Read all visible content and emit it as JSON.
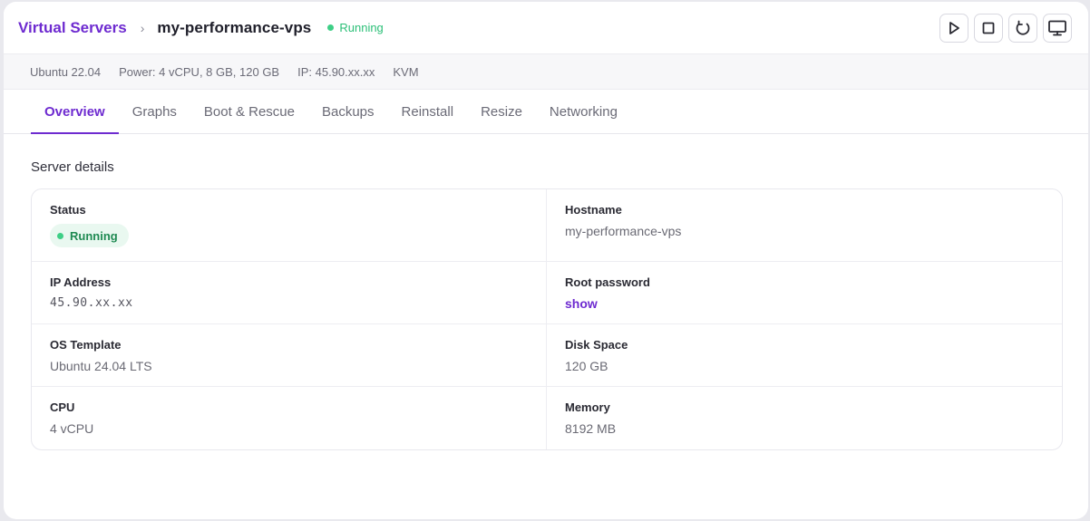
{
  "breadcrumb": {
    "parent_label": "Virtual Servers",
    "separator": "›",
    "server_name": "my-performance-vps",
    "status": "Running"
  },
  "actions": [
    {
      "name": "start-button",
      "icon": "play-icon"
    },
    {
      "name": "stop-button",
      "icon": "stop-icon"
    },
    {
      "name": "restart-button",
      "icon": "restart-icon"
    },
    {
      "name": "console-button",
      "icon": "monitor-icon"
    }
  ],
  "meta": {
    "os": "Ubuntu 22.04",
    "power": "Power: 4 vCPU, 8 GB, 120 GB",
    "ip": "IP: 45.90.xx.xx",
    "virt": "KVM"
  },
  "tabs": [
    {
      "label": "Overview",
      "active": true
    },
    {
      "label": "Graphs"
    },
    {
      "label": "Boot & Rescue"
    },
    {
      "label": "Backups"
    },
    {
      "label": "Reinstall"
    },
    {
      "label": "Resize"
    },
    {
      "label": "Networking"
    }
  ],
  "details": {
    "title": "Server details",
    "status_label": "Status",
    "status_value": "Running",
    "hostname_label": "Hostname",
    "hostname_value": "my-performance-vps",
    "ip_label": "IP Address",
    "ip_value": "45.90.xx.xx",
    "root_label": "Root password",
    "root_value": "show",
    "os_label": "OS Template",
    "os_value": "Ubuntu 24.04 LTS",
    "disk_label": "Disk Space",
    "disk_value": "120 GB",
    "cpu_label": "CPU",
    "cpu_value": "4 vCPU",
    "memory_label": "Memory",
    "memory_value": "8192 MB"
  },
  "colors": {
    "accent": "#6e2bd0",
    "running": "#3ecf86"
  }
}
